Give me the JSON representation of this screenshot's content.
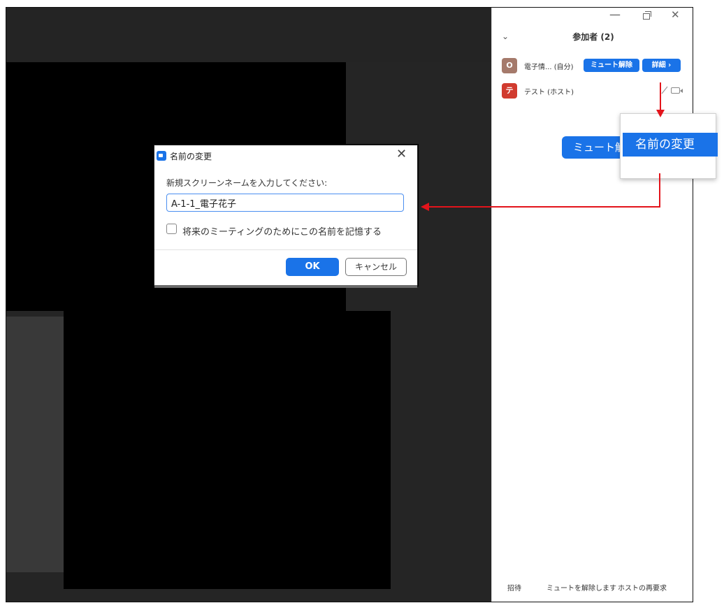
{
  "window": {
    "minimize_glyph": "—",
    "close_glyph": "✕"
  },
  "participants_panel": {
    "title": "参加者 (2)",
    "participants": [
      {
        "avatar_letter": "O",
        "avatar_color": "#a57a6b",
        "name": "電子情... (自分)",
        "unmute_label": "ミュート解除",
        "more_label": "詳細 ›"
      },
      {
        "avatar_letter": "テ",
        "avatar_color": "#d13b2f",
        "name": "テスト (ホスト)"
      }
    ],
    "big_unmute_label": "ミュート解",
    "footer": {
      "invite": "招待",
      "unmute_all": "ミュートを解除します",
      "reclaim_host": "ホストの再要求"
    }
  },
  "context_menu": {
    "rename": "名前の変更"
  },
  "rename_dialog": {
    "title": "名前の変更",
    "close_glyph": "✕",
    "prompt": "新規スクリーンネームを入力してください:",
    "input_value": "A-1-1_電子花子",
    "remember_label": "将来のミーティングのためにこの名前を記憶する",
    "ok_label": "OK",
    "cancel_label": "キャンセル"
  },
  "colors": {
    "accent_blue": "#1a73e8",
    "annotation_red": "#e3141b"
  }
}
